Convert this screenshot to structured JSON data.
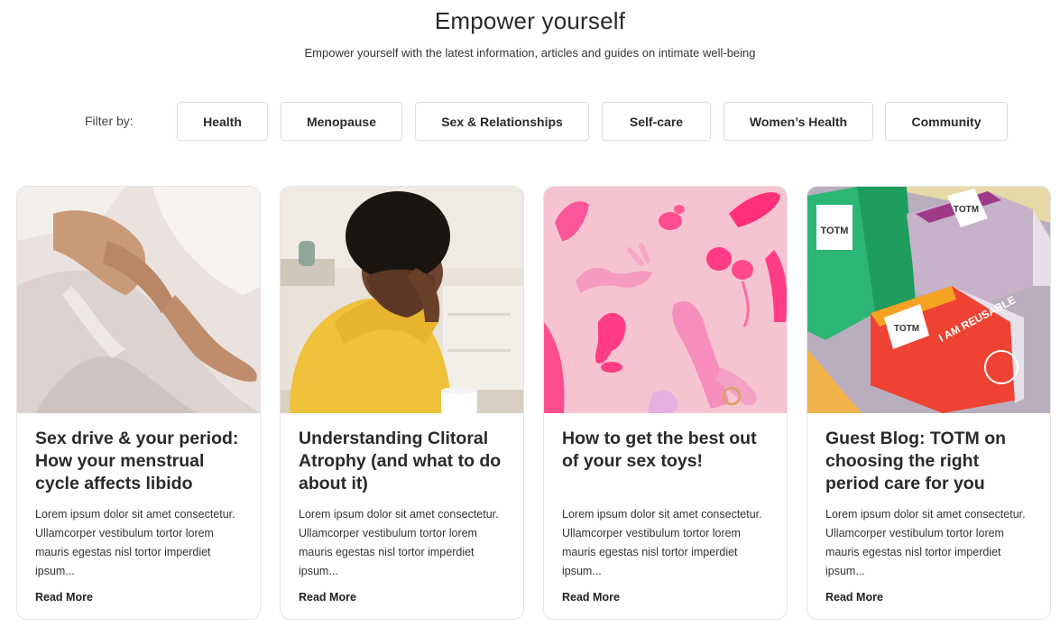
{
  "header": {
    "title": "Empower yourself",
    "subtitle": "Empower yourself with the latest information, articles and guides on intimate well-being"
  },
  "filters": {
    "label": "Filter by:",
    "chips": [
      "Health",
      "Menopause",
      "Sex & Relationships",
      "Self-care",
      "Women’s Health",
      "Community"
    ]
  },
  "cards": [
    {
      "title": "Sex drive & your period: How your menstrual cycle affects libido",
      "excerpt": "Lorem ipsum dolor sit amet consectetur. Ullamcorper vestibulum tortor lorem mauris egestas nisl tortor imperdiet ipsum...",
      "read_more": "Read More"
    },
    {
      "title": "Understanding Clitoral Atrophy  (and what to do about it)",
      "excerpt": "Lorem ipsum dolor sit amet consectetur. Ullamcorper vestibulum tortor lorem mauris egestas nisl tortor imperdiet ipsum...",
      "read_more": "Read More"
    },
    {
      "title": "How to get the best out of your sex toys!",
      "excerpt": "Lorem ipsum dolor sit amet consectetur. Ullamcorper vestibulum tortor lorem mauris egestas nisl tortor imperdiet ipsum...",
      "read_more": "Read More"
    },
    {
      "title": "Guest Blog: TOTM on choosing the right period care for you",
      "excerpt": "Lorem ipsum dolor sit amet consectetur. Ullamcorper vestibulum tortor lorem mauris egestas nisl tortor imperdiet ipsum...",
      "read_more": "Read More",
      "image_text": [
        "TOTM",
        "I AM REUSABLE"
      ]
    }
  ]
}
